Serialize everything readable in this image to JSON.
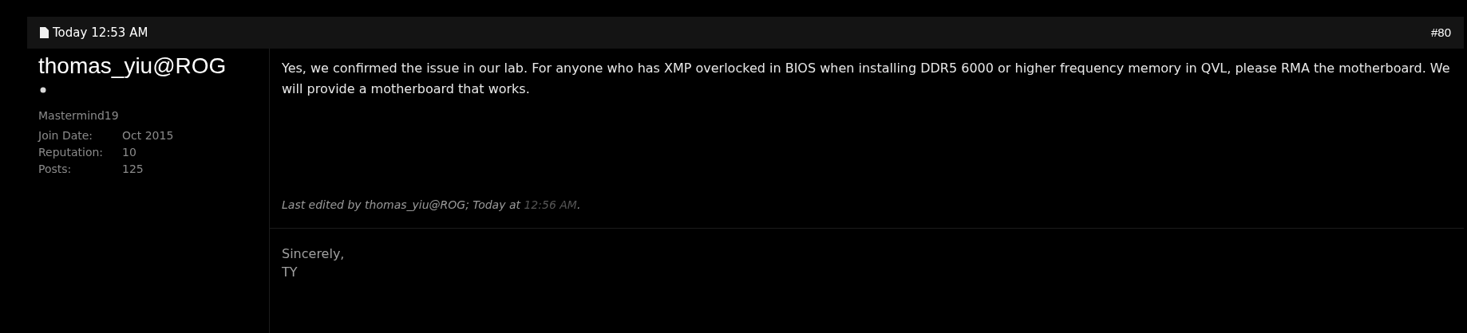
{
  "post_header": {
    "date": "Today 12:53 AM",
    "post_number": "#80"
  },
  "author": {
    "username": "thomas_yiu@ROG",
    "rank": "Mastermind19",
    "stats": [
      {
        "label": "Join Date:",
        "value": "Oct 2015"
      },
      {
        "label": "Reputation:",
        "value": "10"
      },
      {
        "label": "Posts:",
        "value": "125"
      }
    ]
  },
  "message": "Yes, we confirmed the issue in our lab. For anyone who has XMP overlocked in BIOS when installing DDR5 6000 or higher frequency memory in QVL, please RMA the motherboard. We will provide a motherboard that works.",
  "edit_note": {
    "text": "Last edited by thomas_yiu@ROG; Today at",
    "time": "12:56 AM",
    "end": "."
  },
  "signature": [
    "Sincerely,",
    "TY"
  ]
}
